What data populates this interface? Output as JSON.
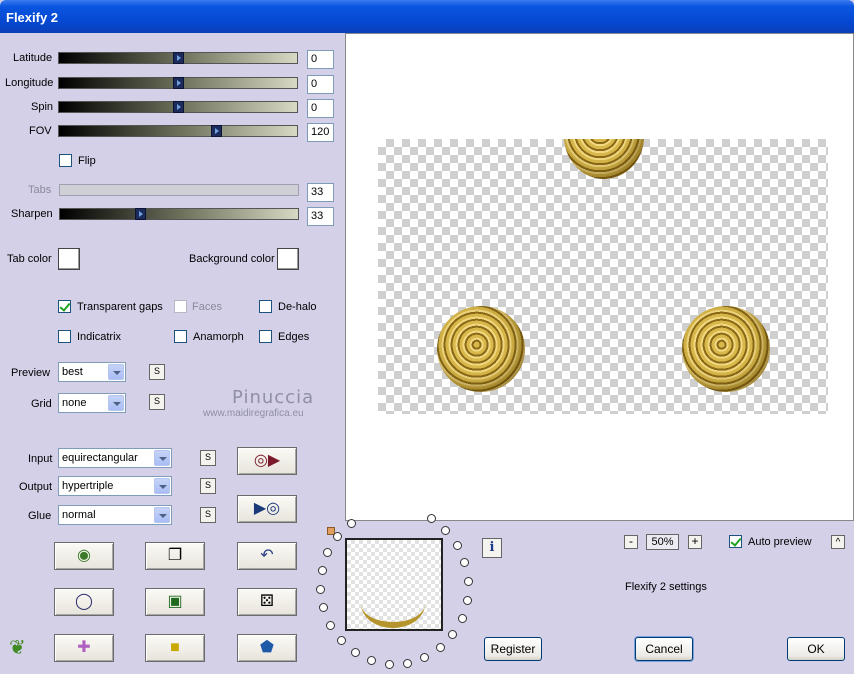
{
  "window": {
    "title": "Flexify 2"
  },
  "sliders": {
    "latitude": {
      "label": "Latitude",
      "value": "0",
      "position": 0.5
    },
    "longitude": {
      "label": "Longitude",
      "value": "0",
      "position": 0.5
    },
    "spin": {
      "label": "Spin",
      "value": "0",
      "position": 0.5
    },
    "fov": {
      "label": "FOV",
      "value": "120",
      "position": 0.66
    },
    "tabs": {
      "label": "Tabs",
      "value": "33",
      "disabled": true
    },
    "sharpen": {
      "label": "Sharpen",
      "value": "33",
      "position": 0.33
    }
  },
  "flip": {
    "label": "Flip",
    "checked": false
  },
  "colors": {
    "tab_color_label": "Tab color",
    "background_color_label": "Background color",
    "tab_color": "#ffffff",
    "background_color": "#ffffff"
  },
  "options": {
    "transparent_gaps": {
      "label": "Transparent gaps",
      "checked": true
    },
    "faces": {
      "label": "Faces",
      "checked": false,
      "disabled": true
    },
    "de_halo": {
      "label": "De-halo",
      "checked": false
    },
    "indicatrix": {
      "label": "Indicatrix",
      "checked": false
    },
    "anamorph": {
      "label": "Anamorph",
      "checked": false
    },
    "edges": {
      "label": "Edges",
      "checked": false
    }
  },
  "preview_select": {
    "label": "Preview",
    "value": "best"
  },
  "grid_select": {
    "label": "Grid",
    "value": "none"
  },
  "input_select": {
    "label": "Input",
    "value": "equirectangular"
  },
  "output_select": {
    "label": "Output",
    "value": "hypertriple"
  },
  "glue_select": {
    "label": "Glue",
    "value": "normal"
  },
  "small_button_label": "S",
  "watermark": {
    "name": "Pinuccia",
    "url": "www.maidiregrafica.eu"
  },
  "zoom": {
    "minus": "-",
    "value": "50%",
    "plus": "+"
  },
  "auto_preview": {
    "label": "Auto preview",
    "checked": true
  },
  "settings_text": "Flexify 2 settings",
  "buttons": {
    "register": "Register",
    "cancel": "Cancel",
    "ok": "OK",
    "info": "i",
    "up": "^"
  },
  "accent_color": "#0a55e0"
}
